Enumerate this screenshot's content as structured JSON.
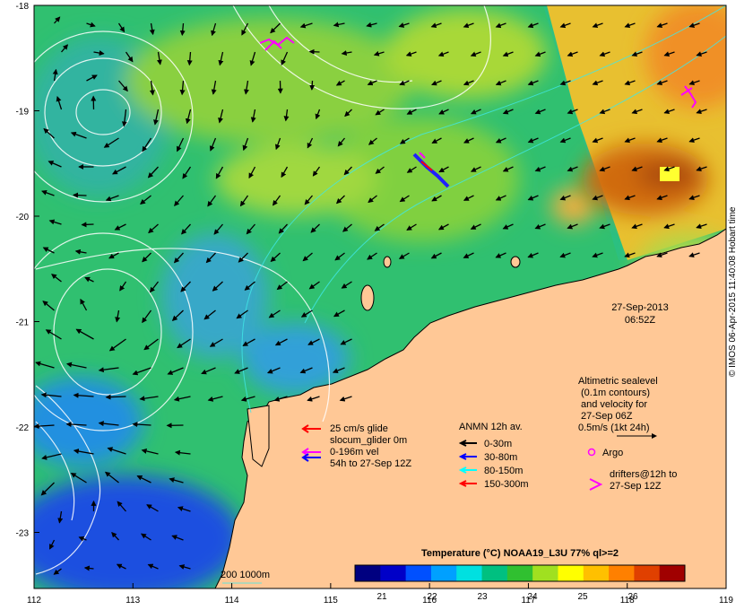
{
  "map": {
    "lon_ticks": [
      "112",
      "113",
      "114",
      "115",
      "116",
      "117",
      "118",
      "119"
    ],
    "lat_ticks": [
      "-18",
      "-19",
      "-20",
      "-21",
      "-22",
      "-23"
    ],
    "timestamp": {
      "date": "27-Sep-2013",
      "time": "06:52Z"
    },
    "altimetry_legend": [
      "Altimetric sealevel",
      "(0.1m contours)",
      "and velocity for",
      "27-Sep 06Z",
      "0.5m/s (1kt 24h)"
    ],
    "glider_legend": [
      {
        "text": "25 cm/s glide",
        "color": "#ff0000"
      },
      {
        "text": "slocum_glider 0m",
        "color": ""
      },
      {
        "text": "0-196m vel",
        "color": "#ff00ff"
      },
      {
        "text": "54h to 27-Sep 12Z",
        "color": "#0000ff"
      }
    ],
    "anmn_legend": {
      "title": "ANMN 12h av.",
      "items": [
        {
          "text": "0-30m",
          "color": "#000000"
        },
        {
          "text": "30-80m",
          "color": "#0000ff"
        },
        {
          "text": "80-150m",
          "color": "#00ffff"
        },
        {
          "text": "150-300m",
          "color": "#ff0000"
        }
      ]
    },
    "argo_label": "Argo",
    "drifters_label": [
      "drifters@12h to",
      "27-Sep 12Z"
    ],
    "depth_legend": "200  1000m",
    "colorbar": {
      "title": "Temperature (°C) NOAA19_L3U 77% ql>=2",
      "ticks": [
        "21",
        "22",
        "23",
        "24",
        "25",
        "26"
      ],
      "colors": [
        "#000080",
        "#0000c8",
        "#0050ff",
        "#00a0ff",
        "#00e0e0",
        "#00c080",
        "#30c030",
        "#a0e020",
        "#ffff00",
        "#ffc000",
        "#ff8000",
        "#e04000",
        "#a00000"
      ]
    },
    "credit": "© IMOS 06-Apr-2015 11:40:08 Hobart time"
  }
}
